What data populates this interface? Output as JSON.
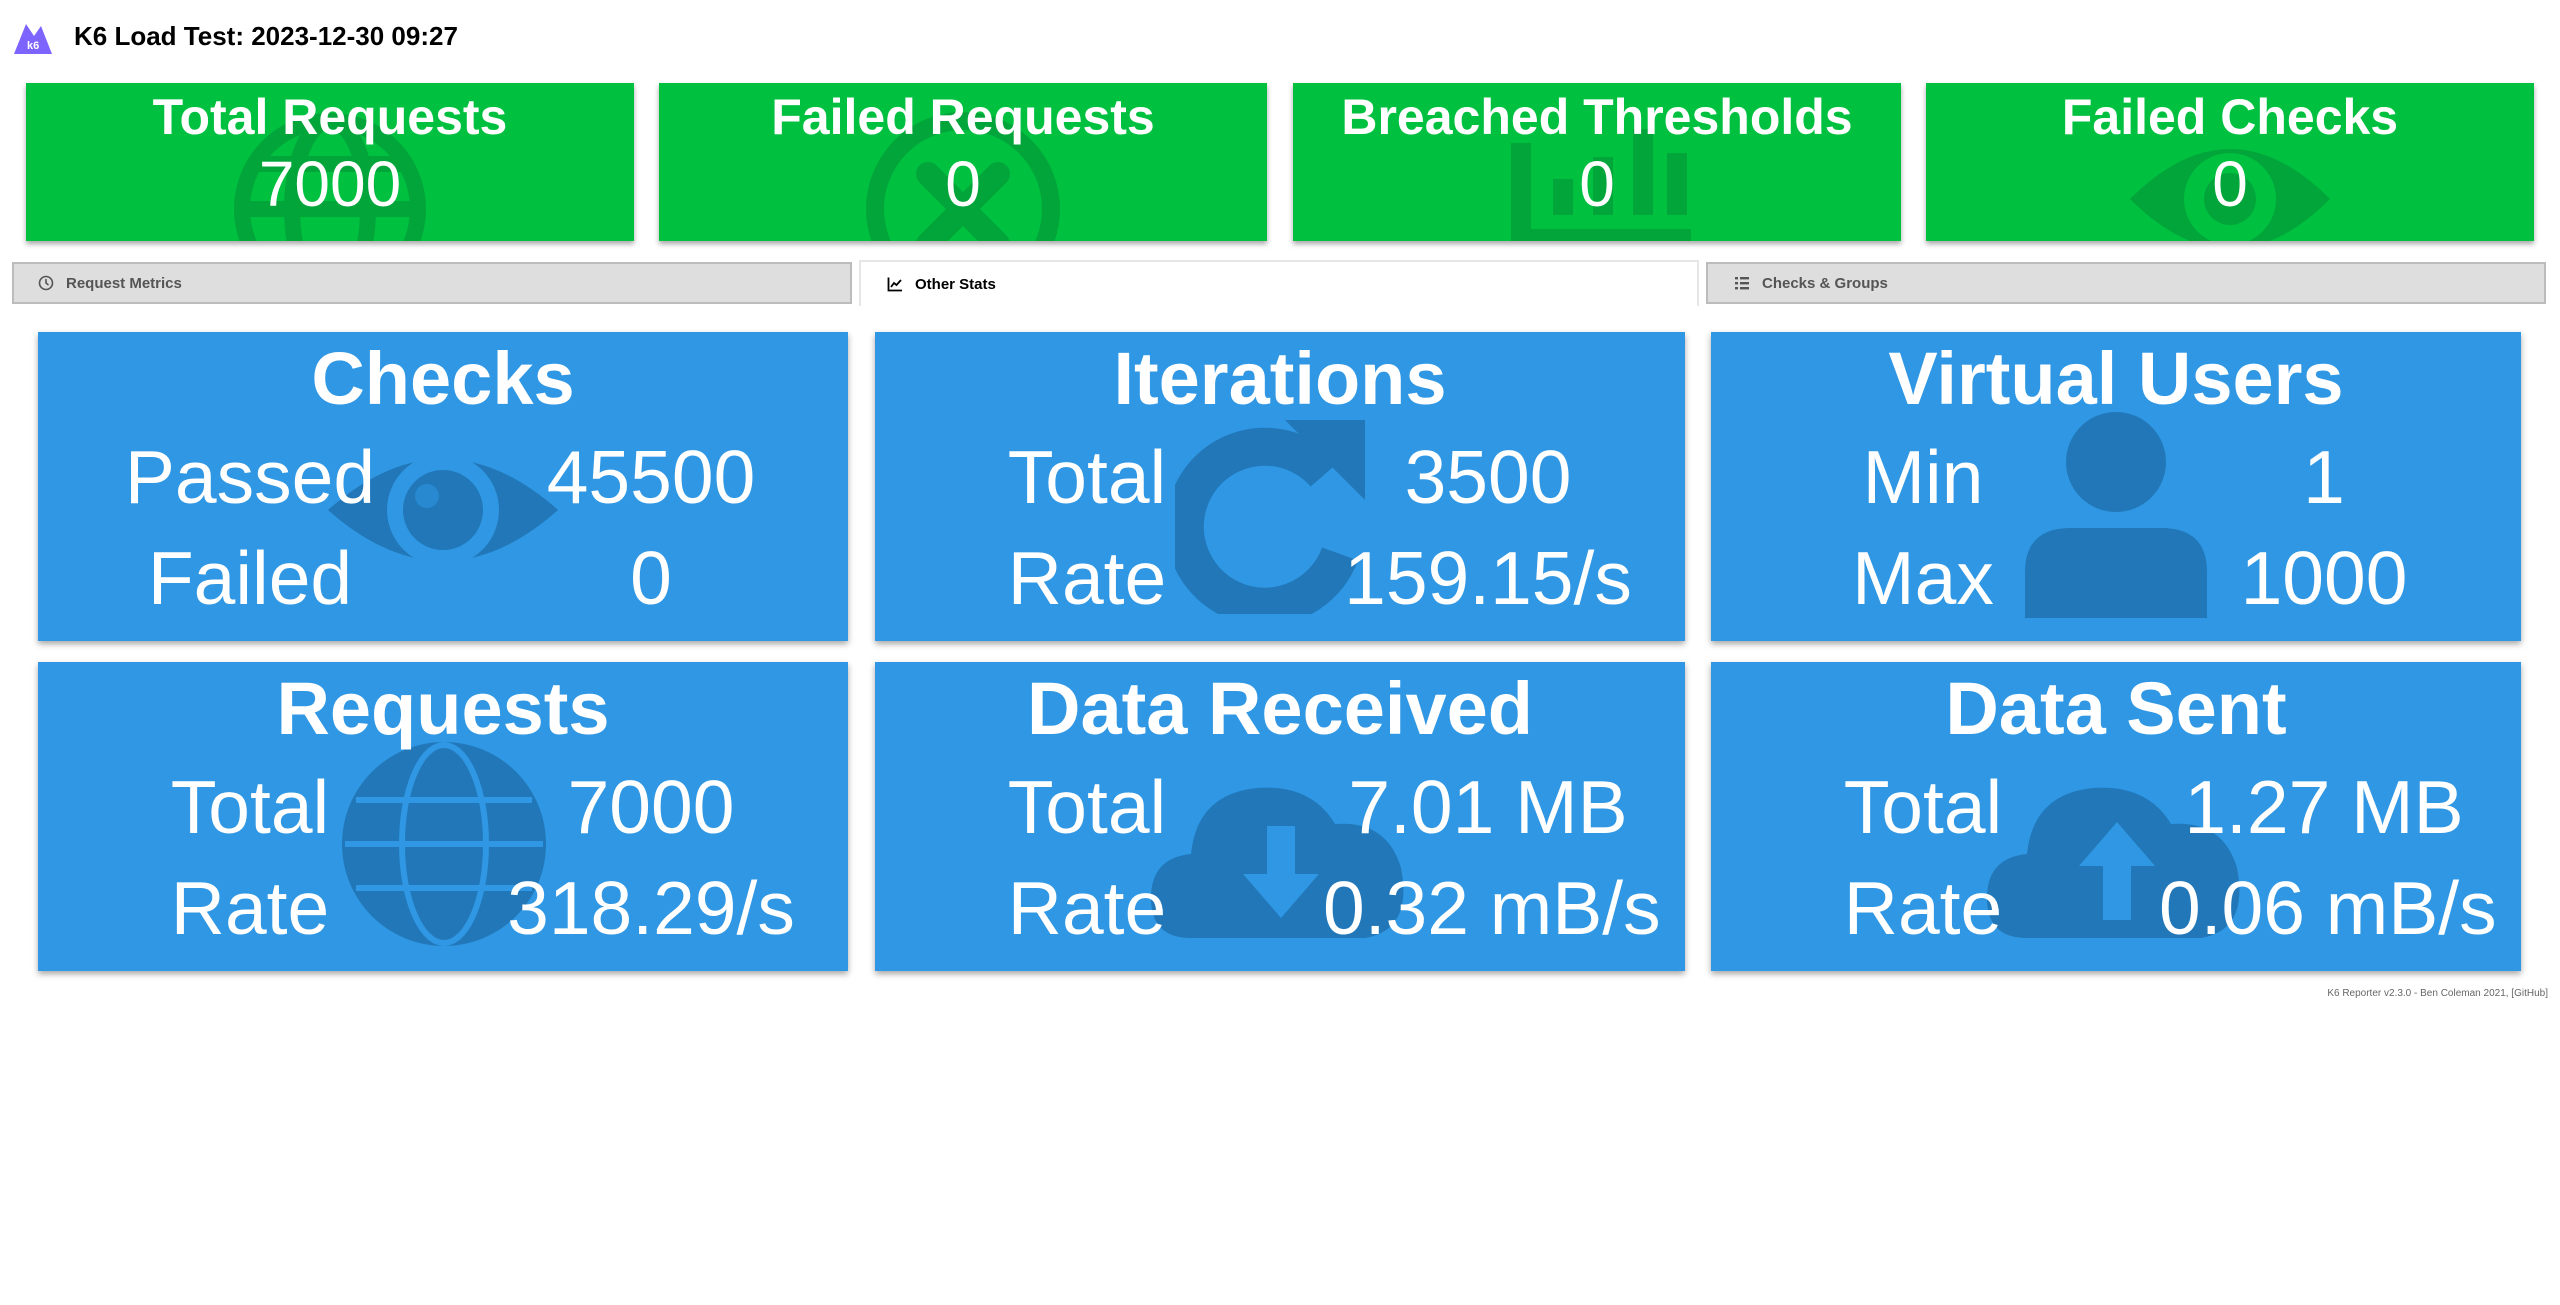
{
  "header": {
    "title": "K6 Load Test: 2023-12-30 09:27",
    "logo_text": "k6",
    "logo_icon": "k6-mountain-logo"
  },
  "summary": [
    {
      "title": "Total Requests",
      "value": "7000",
      "icon": "globe-icon"
    },
    {
      "title": "Failed Requests",
      "value": "0",
      "icon": "x-circle-icon"
    },
    {
      "title": "Breached Thresholds",
      "value": "0",
      "icon": "chart-icon"
    },
    {
      "title": "Failed Checks",
      "value": "0",
      "icon": "eye-icon"
    }
  ],
  "tabs": [
    {
      "label": "Request Metrics",
      "icon": "clock-icon",
      "active": false
    },
    {
      "label": "Other Stats",
      "icon": "chart-line-icon",
      "active": true
    },
    {
      "label": "Checks & Groups",
      "icon": "list-icon",
      "active": false
    }
  ],
  "stats": {
    "checks": {
      "title": "Checks",
      "row1_label": "Passed",
      "row1_value": "45500",
      "row2_label": "Failed",
      "row2_value": "0",
      "icon": "eye-icon"
    },
    "iterations": {
      "title": "Iterations",
      "row1_label": "Total",
      "row1_value": "3500",
      "row2_label": "Rate",
      "row2_value": "159.15/s",
      "icon": "redo-icon"
    },
    "virtual_users": {
      "title": "Virtual Users",
      "row1_label": "Min",
      "row1_value": "1",
      "row2_label": "Max",
      "row2_value": "1000",
      "icon": "user-icon"
    },
    "requests": {
      "title": "Requests",
      "row1_label": "Total",
      "row1_value": "7000",
      "row2_label": "Rate",
      "row2_value": "318.29/s",
      "icon": "globe-icon"
    },
    "data_received": {
      "title": "Data Received",
      "row1_label": "Total",
      "row1_value": "7.01 MB",
      "row2_label": "Rate",
      "row2_value": "0.32 mB/s",
      "icon": "cloud-download-icon"
    },
    "data_sent": {
      "title": "Data Sent",
      "row1_label": "Total",
      "row1_value": "1.27 MB",
      "row2_label": "Rate",
      "row2_value": "0.06 mB/s",
      "icon": "cloud-upload-icon"
    }
  },
  "footer": {
    "text": "K6 Reporter v2.3.0 - Ben Coleman 2021, [GitHub]"
  },
  "colors": {
    "summary_green": "#00c03f",
    "stat_blue": "#2f97e3",
    "icon_shade_blue": "#2177b8",
    "icon_shade_green": "#02a53a",
    "logo_purple": "#7d64ff"
  }
}
